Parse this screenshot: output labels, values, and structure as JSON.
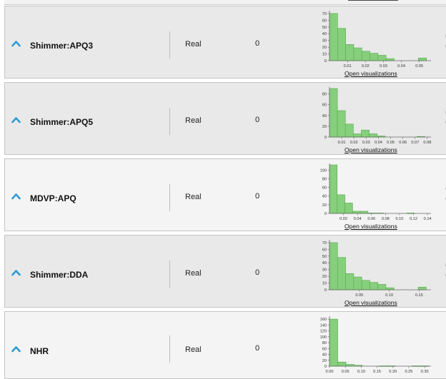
{
  "rows": [
    {
      "name": "Shimmer:APQ3",
      "type": "Real",
      "missing": "0",
      "link": "Open visualizations",
      "edge": [
        "(",
        "("
      ],
      "chart_data": {
        "type": "bar",
        "yticks": [
          0,
          10,
          20,
          30,
          40,
          50,
          60,
          70
        ],
        "ylim": [
          0,
          72
        ],
        "xticks": [
          0.01,
          0.02,
          0.03,
          0.04,
          0.05
        ],
        "xticklabels": [
          "0.01",
          "0.02",
          "0.03",
          "0.04",
          "0.05"
        ],
        "xlim": [
          0.0,
          0.0565
        ],
        "bins": [
          0.0,
          0.0045,
          0.009,
          0.0135,
          0.018,
          0.0225,
          0.027,
          0.0315,
          0.036,
          0.0405,
          0.045,
          0.0495,
          0.054
        ],
        "values": [
          70,
          48,
          24,
          19,
          14,
          11,
          8,
          3,
          0,
          0,
          0,
          4
        ]
      }
    },
    {
      "name": "Shimmer:APQ5",
      "type": "Real",
      "missing": "0",
      "link": "Open visualizations",
      "edge": [
        "(",
        "("
      ],
      "chart_data": {
        "type": "bar",
        "yticks": [
          0,
          20,
          40,
          60,
          80
        ],
        "ylim": [
          0,
          90
        ],
        "xticks": [
          0.01,
          0.02,
          0.03,
          0.04,
          0.05,
          0.06,
          0.07,
          0.08
        ],
        "xticklabels": [
          "0.01",
          "0.02",
          "0.03",
          "0.04",
          "0.05",
          "0.06",
          "0.07",
          "0.08"
        ],
        "xlim": [
          0.0,
          0.083
        ],
        "bins": [
          0.0,
          0.0065,
          0.013,
          0.0195,
          0.026,
          0.0325,
          0.039,
          0.0455,
          0.052,
          0.0585,
          0.065,
          0.0715,
          0.078
        ],
        "values": [
          90,
          49,
          24,
          6,
          13,
          6,
          2,
          0,
          0,
          0,
          0,
          1
        ]
      }
    },
    {
      "name": "MDVP:APQ",
      "type": "Real",
      "missing": "0",
      "link": "Open visualizations",
      "edge": [
        "(",
        "("
      ],
      "chart_data": {
        "type": "bar",
        "yticks": [
          0,
          20,
          40,
          60,
          80,
          100
        ],
        "ylim": [
          0,
          112
        ],
        "xticks": [
          0.02,
          0.04,
          0.06,
          0.08,
          0.1,
          0.12,
          0.14
        ],
        "xticklabels": [
          "0.02",
          "0.04",
          "0.06",
          "0.08",
          "0.10",
          "0.12",
          "0.14"
        ],
        "xlim": [
          0.0,
          0.145
        ],
        "bins": [
          0.0,
          0.011,
          0.022,
          0.033,
          0.044,
          0.055,
          0.066,
          0.077,
          0.088,
          0.099,
          0.11,
          0.121,
          0.132
        ],
        "values": [
          112,
          43,
          24,
          5,
          5,
          1,
          1,
          0,
          0,
          0,
          1,
          0
        ]
      }
    },
    {
      "name": "Shimmer:DDA",
      "type": "Real",
      "missing": "0",
      "link": "Open visualizations",
      "edge": [
        "(",
        "("
      ],
      "chart_data": {
        "type": "bar",
        "yticks": [
          0,
          10,
          20,
          30,
          40,
          50,
          60,
          70
        ],
        "ylim": [
          0,
          72
        ],
        "xticks": [
          0.05,
          0.1,
          0.15
        ],
        "xticklabels": [
          "0.05",
          "0.10",
          "0.15"
        ],
        "xlim": [
          0.0,
          0.17
        ],
        "bins": [
          0.0,
          0.0135,
          0.027,
          0.0405,
          0.054,
          0.0675,
          0.081,
          0.0945,
          0.108,
          0.1215,
          0.135,
          0.1485,
          0.162
        ],
        "values": [
          70,
          48,
          24,
          19,
          14,
          11,
          8,
          3,
          0,
          0,
          0,
          4
        ]
      }
    },
    {
      "name": "NHR",
      "type": "Real",
      "missing": "0",
      "link": "",
      "edge": [],
      "chart_data": {
        "type": "bar",
        "yticks": [
          0,
          20,
          40,
          60,
          80,
          100,
          120,
          140,
          160
        ],
        "ylim": [
          0,
          165
        ],
        "xticks": [
          0.0,
          0.05,
          0.1,
          0.15,
          0.2,
          0.25,
          0.3
        ],
        "xticklabels": [
          "0.00",
          "0.05",
          "0.10",
          "0.15",
          "0.20",
          "0.25",
          "0.30"
        ],
        "xlim": [
          0.0,
          0.32
        ],
        "bins": [
          0.0,
          0.026,
          0.052,
          0.078,
          0.104,
          0.13,
          0.156,
          0.182,
          0.208,
          0.234,
          0.26,
          0.286,
          0.312
        ],
        "values": [
          160,
          14,
          6,
          3,
          0,
          0,
          1,
          1,
          0,
          0,
          1,
          1
        ]
      }
    }
  ],
  "colors": {
    "bar_fill": "#86cf7c",
    "bar_stroke": "#5aa94f",
    "chevron": "#2d9bd6",
    "axis": "#666666"
  }
}
